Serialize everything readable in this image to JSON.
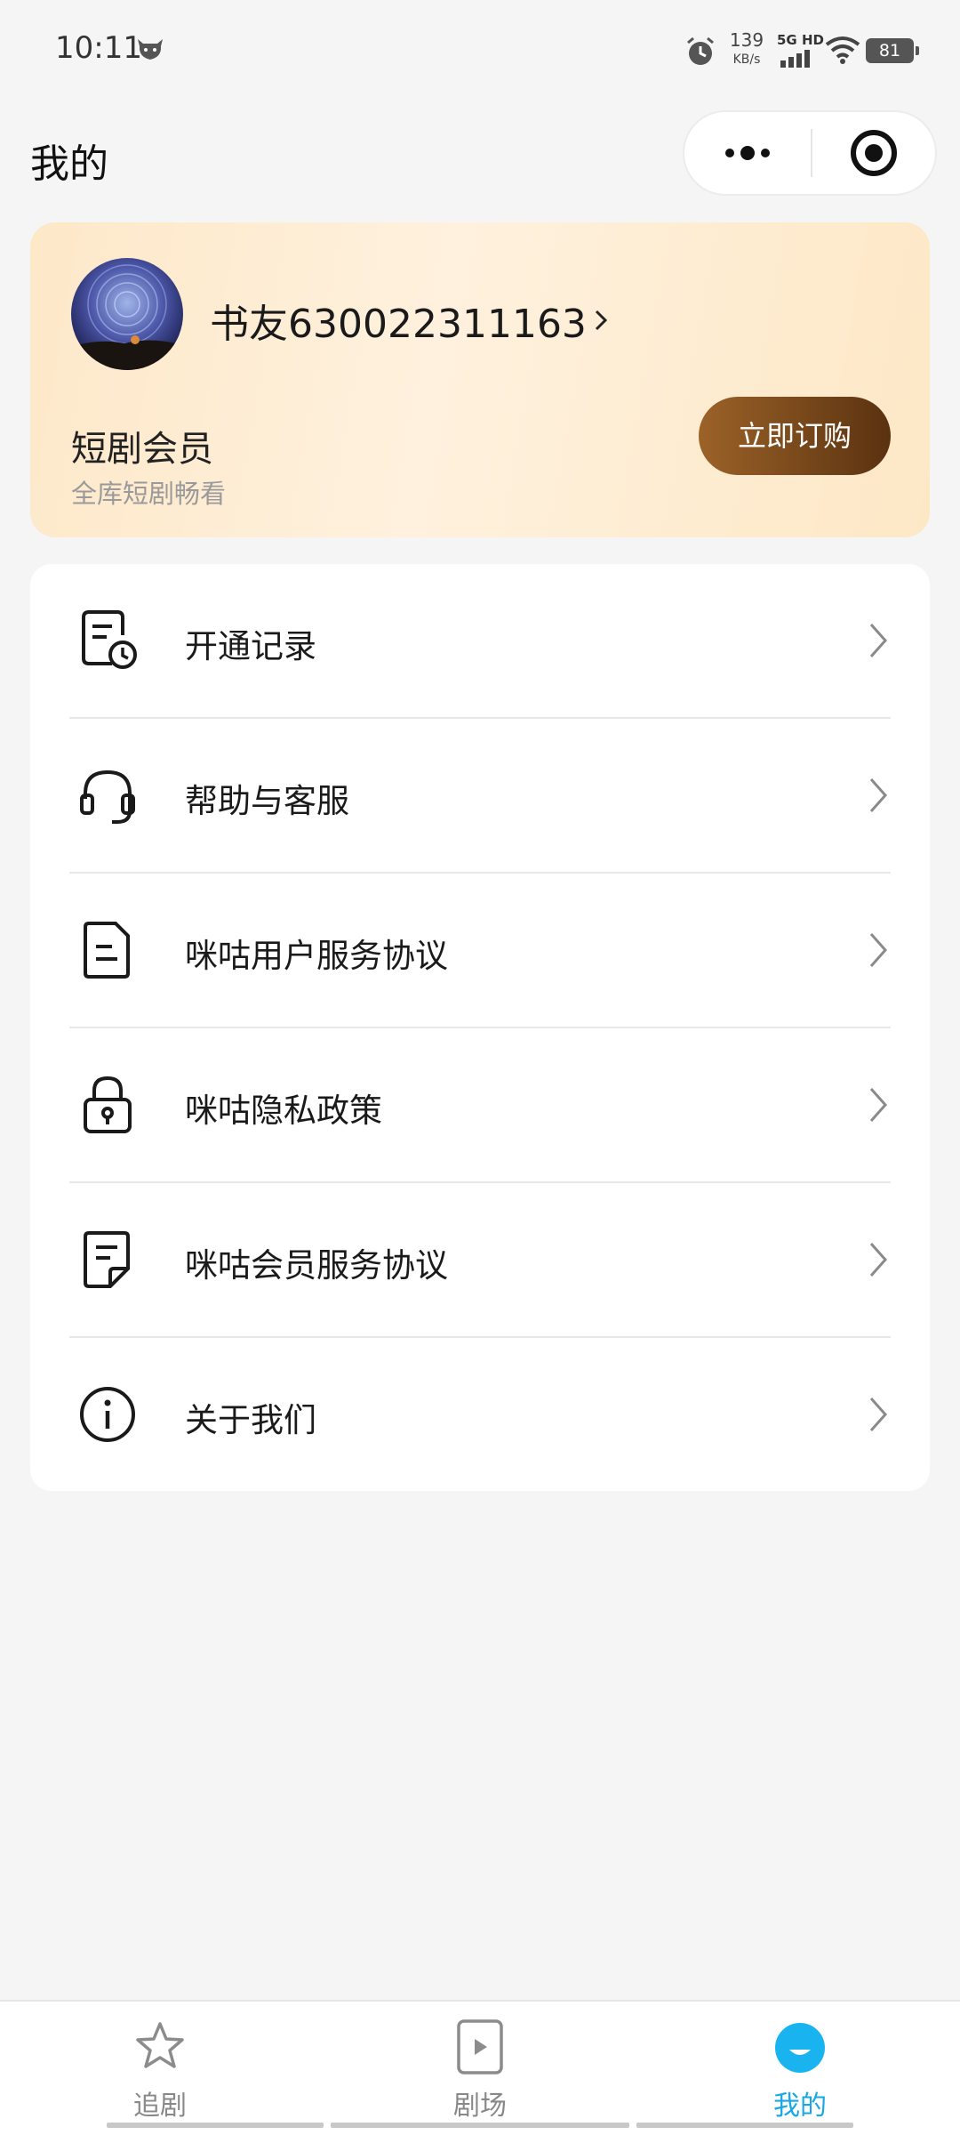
{
  "status_bar": {
    "time": "10:11",
    "net_speed": "139",
    "net_unit": "KB/s",
    "network": "5G HD",
    "battery": "81"
  },
  "header": {
    "title": "我的"
  },
  "member_card": {
    "username": "书友630022311163",
    "vip_title": "短剧会员",
    "vip_subtitle": "全库短剧畅看",
    "subscribe_label": "立即订购"
  },
  "menu": {
    "items": [
      {
        "label": "开通记录",
        "icon": "record-icon"
      },
      {
        "label": "帮助与客服",
        "icon": "headset-icon"
      },
      {
        "label": "咪咕用户服务协议",
        "icon": "document-icon"
      },
      {
        "label": "咪咕隐私政策",
        "icon": "lock-icon"
      },
      {
        "label": "咪咕会员服务协议",
        "icon": "document-edit-icon"
      },
      {
        "label": "关于我们",
        "icon": "info-icon"
      }
    ]
  },
  "tabs": [
    {
      "label": "追剧",
      "icon": "star-icon",
      "active": false
    },
    {
      "label": "剧场",
      "icon": "play-icon",
      "active": false
    },
    {
      "label": "我的",
      "icon": "profile-icon",
      "active": true
    }
  ],
  "colors": {
    "accent": "#16a8e6",
    "subscribe_button": "#7a4a1c",
    "card_bg": "#fde8c8"
  }
}
